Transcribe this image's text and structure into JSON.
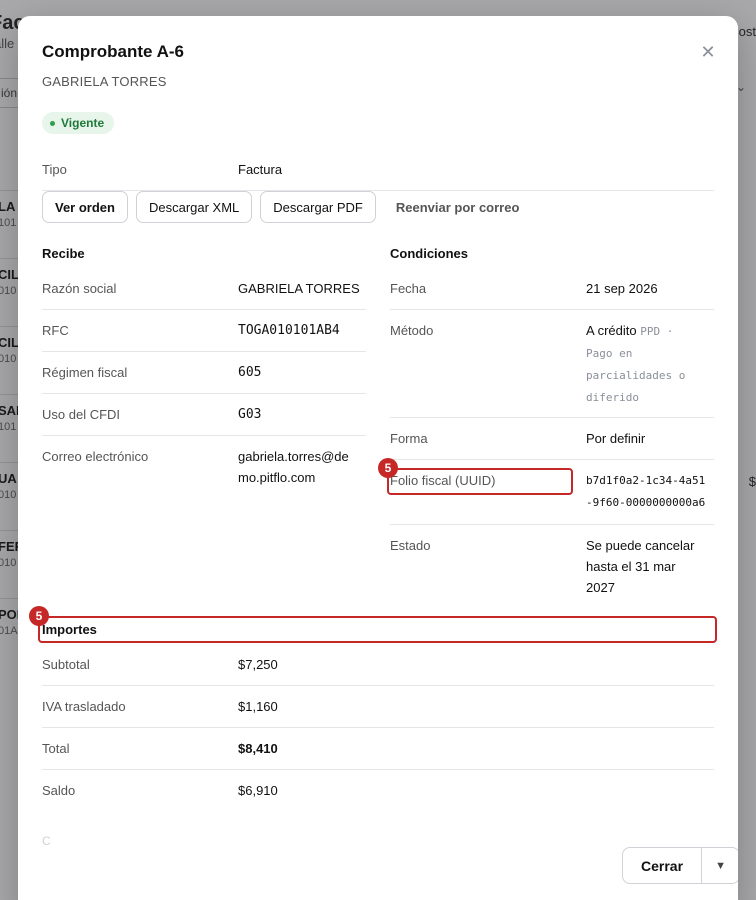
{
  "background": {
    "title_fragment": "Fac",
    "subtitle_fragment": "alle",
    "filter_fragment": "ión",
    "right_top_fragment": "ost",
    "right_dollar_fragment": "$",
    "rows": [
      {
        "a": "LA",
        "b": "101"
      },
      {
        "a": "CIL",
        "b": "010"
      },
      {
        "a": "CIL",
        "b": "010"
      },
      {
        "a": "SAN",
        "b": "101"
      },
      {
        "a": "UA",
        "b": "010"
      },
      {
        "a": "FER",
        "b": "010"
      },
      {
        "a": "POR",
        "b": "01A"
      }
    ]
  },
  "modal": {
    "title": "Comprobante A-6",
    "subtitle": "GABRIELA TORRES",
    "close_icon": "close-icon",
    "status_badge": "Vigente",
    "tipo": {
      "label": "Tipo",
      "value": "Factura"
    },
    "actions": {
      "ver_orden": "Ver orden",
      "descargar_xml": "Descargar XML",
      "descargar_pdf": "Descargar PDF",
      "reenviar": "Reenviar por correo"
    },
    "recibe": {
      "heading": "Recibe",
      "rows": [
        {
          "label": "Razón social",
          "value": "GABRIELA TORRES"
        },
        {
          "label": "RFC",
          "value": "TOGA010101AB4"
        },
        {
          "label": "Régimen fiscal",
          "value": "605"
        },
        {
          "label": "Uso del CFDI",
          "value": "G03"
        },
        {
          "label": "Correo electrónico",
          "value_line1": "gabriela.torres@de",
          "value_line2": "mo.pitflo.com"
        }
      ]
    },
    "condiciones": {
      "heading": "Condiciones",
      "fecha": {
        "label": "Fecha",
        "value": "21 sep 2026"
      },
      "metodo": {
        "label": "Método",
        "value": "A crédito",
        "code": "PPD ·",
        "desc_line1": "Pago en",
        "desc_line2": "parcialidades o",
        "desc_line3": "diferido"
      },
      "forma": {
        "label": "Forma",
        "value": "Por definir"
      },
      "folio": {
        "label": "Folio fiscal (UUID)",
        "value_line1": "b7d1f0a2-1c34-4a51",
        "value_line2": "-9f60-0000000000a6"
      },
      "estado": {
        "label": "Estado",
        "value_line1": "Se puede cancelar",
        "value_line2": "hasta el 31 mar",
        "value_line3": "2027"
      }
    },
    "importes": {
      "heading": "Importes",
      "rows": [
        {
          "label": "Subtotal",
          "value": "$7,250"
        },
        {
          "label": "IVA trasladado",
          "value": "$1,160"
        },
        {
          "label": "Total",
          "value": "$8,410"
        },
        {
          "label": "Saldo",
          "value": "$6,910"
        }
      ]
    },
    "faded_text": "C",
    "footer": {
      "close_label": "Cerrar",
      "menu_icon": "chevron-down-icon"
    }
  },
  "highlights": [
    {
      "badge": "5"
    },
    {
      "badge": "5"
    }
  ],
  "colors": {
    "accent_red": "#c62828",
    "badge_green": "#1f7a3a",
    "badge_bg": "#e7f5ea"
  }
}
